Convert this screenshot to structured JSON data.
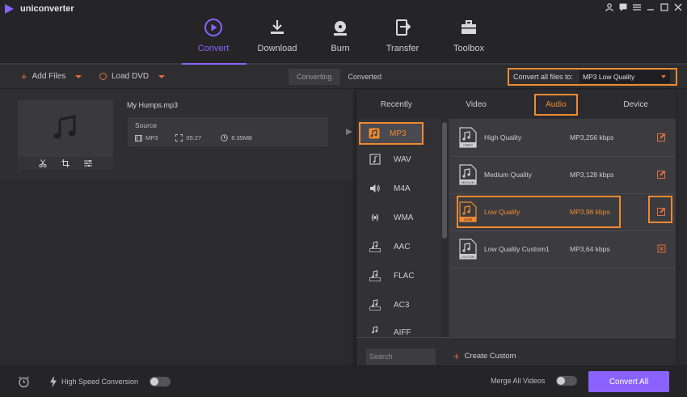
{
  "app": {
    "name": "uniconverter"
  },
  "nav": [
    {
      "label": "Convert",
      "icon": "convert-icon"
    },
    {
      "label": "Download",
      "icon": "download-icon"
    },
    {
      "label": "Burn",
      "icon": "burn-icon"
    },
    {
      "label": "Transfer",
      "icon": "transfer-icon"
    },
    {
      "label": "Toolbox",
      "icon": "toolbox-icon"
    }
  ],
  "toolbar": {
    "add_files": "Add Files",
    "load_dvd": "Load DVD",
    "tab_converting": "Converting",
    "tab_converted": "Converted",
    "convert_all_label": "Convert all files to:",
    "convert_all_value": "MP3 Low Quality"
  },
  "file": {
    "name": "My Humps.mp3",
    "source_label": "Source",
    "format": "MP3",
    "duration": "05:27",
    "size": "8.35MB"
  },
  "panel": {
    "tabs": [
      "Recently",
      "Video",
      "Audio",
      "Device"
    ],
    "active_tab": "Audio",
    "formats": [
      {
        "label": "MP3",
        "icon": "mp3-icon"
      },
      {
        "label": "WAV",
        "icon": "wav-icon"
      },
      {
        "label": "M4A",
        "icon": "speaker-icon"
      },
      {
        "label": "WMA",
        "icon": "wma-icon"
      },
      {
        "label": "AAC",
        "icon": "aac-icon"
      },
      {
        "label": "FLAC",
        "icon": "flac-icon"
      },
      {
        "label": "AC3",
        "icon": "ac3-icon"
      },
      {
        "label": "AIFF",
        "icon": "aiff-icon"
      }
    ],
    "qualities": [
      {
        "name": "High Quality",
        "bitrate": "MP3,256 kbps",
        "badge": "HIGH"
      },
      {
        "name": "Medium Quality",
        "bitrate": "MP3,128 kbps",
        "badge": "MEDIUM"
      },
      {
        "name": "Low Quality",
        "bitrate": "MP3,96 kbps",
        "badge": "LOW"
      },
      {
        "name": "Low Quality Custom1",
        "bitrate": "MP3,64 kbps",
        "badge": "CUSTOM"
      }
    ],
    "search_placeholder": "Search",
    "create_custom": "Create Custom"
  },
  "bottom": {
    "high_speed": "High Speed Conversion",
    "merge": "Merge All Videos",
    "convert_all": "Convert All"
  },
  "colors": {
    "accent": "#8a63ff",
    "highlight": "#f08a30",
    "orange_icon": "#e36d3d"
  }
}
